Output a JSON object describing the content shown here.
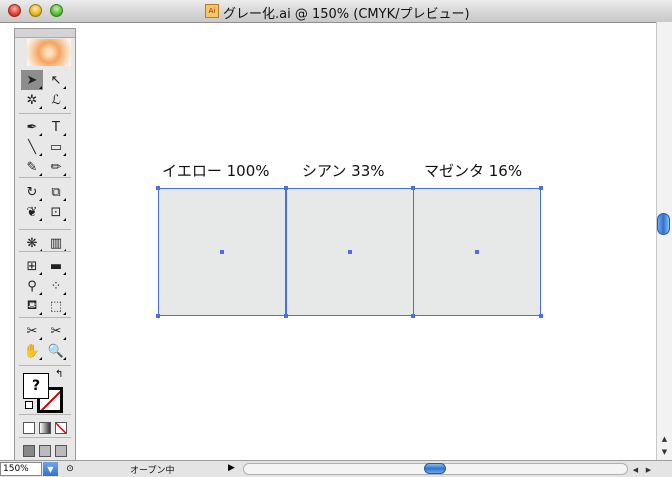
{
  "window": {
    "title": "グレー化.ai @ 150% (CMYK/プレビュー)",
    "doc_icon_label": "Ai"
  },
  "toolbox": {
    "tools": [
      {
        "name": "selection-tool-icon",
        "glyph": "➤"
      },
      {
        "name": "direct-selection-tool-icon",
        "glyph": "↖"
      },
      {
        "name": "magic-wand-tool-icon",
        "glyph": "✲"
      },
      {
        "name": "lasso-tool-icon",
        "glyph": "ℒ"
      },
      {
        "name": "pen-tool-icon",
        "glyph": "✒"
      },
      {
        "name": "type-tool-icon",
        "glyph": "T"
      },
      {
        "name": "line-tool-icon",
        "glyph": "╲"
      },
      {
        "name": "rectangle-tool-icon",
        "glyph": "▭"
      },
      {
        "name": "paintbrush-tool-icon",
        "glyph": "✎"
      },
      {
        "name": "pencil-tool-icon",
        "glyph": "✏"
      },
      {
        "name": "rotate-tool-icon",
        "glyph": "↻"
      },
      {
        "name": "scale-tool-icon",
        "glyph": "⧉"
      },
      {
        "name": "warp-tool-icon",
        "glyph": "❦"
      },
      {
        "name": "free-transform-tool-icon",
        "glyph": "⊡"
      },
      {
        "name": "symbol-sprayer-tool-icon",
        "glyph": "❋"
      },
      {
        "name": "column-graph-tool-icon",
        "glyph": "▥"
      },
      {
        "name": "mesh-tool-icon",
        "glyph": "⊞"
      },
      {
        "name": "gradient-tool-icon",
        "glyph": "▬"
      },
      {
        "name": "eyedropper-tool-icon",
        "glyph": "⚲"
      },
      {
        "name": "blend-tool-icon",
        "glyph": "⁘"
      },
      {
        "name": "live-paint-bucket-tool-icon",
        "glyph": "⛾"
      },
      {
        "name": "live-paint-selection-tool-icon",
        "glyph": "⬚"
      },
      {
        "name": "slice-tool-icon",
        "glyph": "✂"
      },
      {
        "name": "scissors-tool-icon",
        "glyph": "✂"
      },
      {
        "name": "hand-tool-icon",
        "glyph": "✋"
      },
      {
        "name": "zoom-tool-icon",
        "glyph": "🔍"
      }
    ],
    "fill_label": "?",
    "swap_glyph": "↰"
  },
  "canvas": {
    "labels": [
      "イエロー 100%",
      "シアン 33%",
      "マゼンタ 16%"
    ],
    "square_fill": "#e7e9e8",
    "selection_color": "#4a6fe0"
  },
  "statusbar": {
    "zoom": "150%",
    "status_text": "オープン中",
    "arrow": "▶"
  },
  "scroll": {
    "up": "▲",
    "down": "▼",
    "left": "◀",
    "right": "▶"
  }
}
